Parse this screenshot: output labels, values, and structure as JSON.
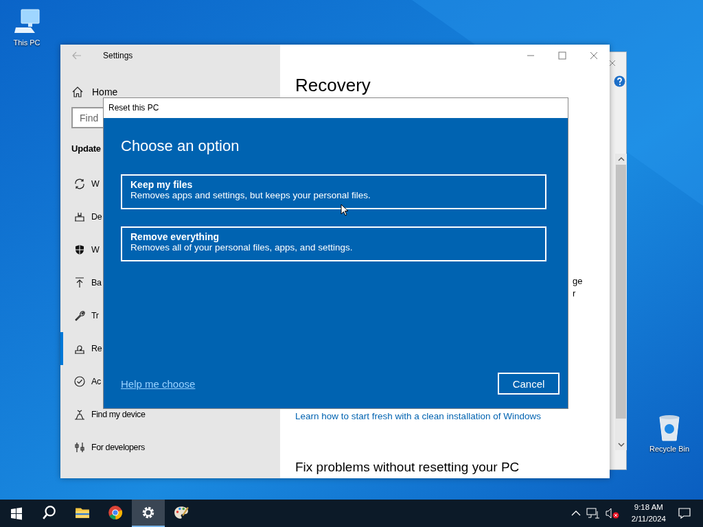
{
  "desktop_icons": [
    {
      "label": "This PC"
    },
    {
      "label": "Recycle Bin"
    }
  ],
  "settings_window": {
    "title": "Settings",
    "sidebar": {
      "home": "Home",
      "search_placeholder": "Find",
      "section": "Update",
      "items": [
        {
          "label": "W",
          "selected": false
        },
        {
          "label": "De",
          "selected": false
        },
        {
          "label": "W",
          "selected": false
        },
        {
          "label": "Ba",
          "selected": false
        },
        {
          "label": "Tr",
          "selected": false
        },
        {
          "label": "Re",
          "selected": true
        },
        {
          "label": "Ac",
          "selected": false
        },
        {
          "label": "Find my device",
          "selected": false
        },
        {
          "label": "For developers",
          "selected": false
        }
      ]
    },
    "content": {
      "heading": "Recovery",
      "fragments": [
        "ge",
        "r"
      ],
      "link": "Learn how to start fresh with a clean installation of Windows",
      "subheading": "Fix problems without resetting your PC"
    }
  },
  "dialog": {
    "title": "Reset this PC",
    "heading": "Choose an option",
    "options": [
      {
        "title": "Keep my files",
        "description": "Removes apps and settings, but keeps your personal files."
      },
      {
        "title": "Remove everything",
        "description": "Removes all of your personal files, apps, and settings."
      }
    ],
    "help_link": "Help me choose",
    "cancel": "Cancel"
  },
  "taskbar": {
    "apps": [
      {
        "selected": false
      },
      {
        "selected": false
      },
      {
        "selected": false
      },
      {
        "selected": true
      },
      {
        "selected": false
      }
    ],
    "time": "9:18 AM",
    "date": "2/11/2024"
  }
}
